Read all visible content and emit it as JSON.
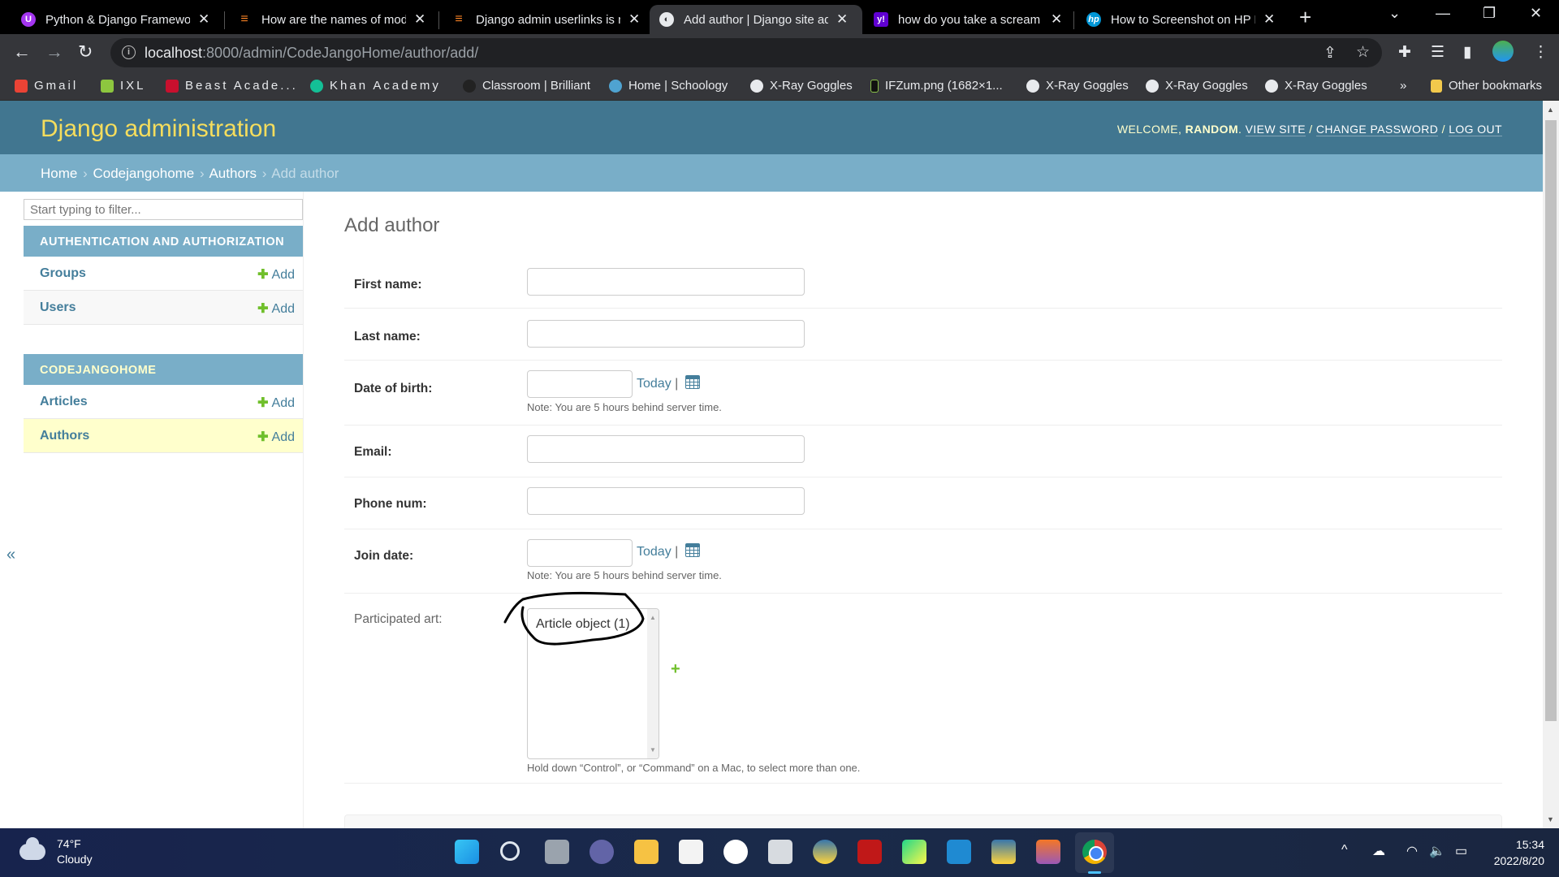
{
  "browser": {
    "tabs": [
      {
        "title": "Python & Django Framework",
        "favicon": "udemy-icon",
        "color": "#a435f0",
        "active": false
      },
      {
        "title": "How are the names of models",
        "favicon": "stackoverflow-icon",
        "color": "#f48024",
        "active": false
      },
      {
        "title": "Django admin userlinks is not",
        "favicon": "stackoverflow-icon",
        "color": "#f48024",
        "active": false
      },
      {
        "title": "Add author | Django site admin",
        "favicon": "globe-icon",
        "color": "#e8eaed",
        "active": true
      },
      {
        "title": "how do you take a scream shot",
        "favicon": "yahoo-icon",
        "color": "#6001d2",
        "active": false
      },
      {
        "title": "How to Screenshot on HP Laptop",
        "favicon": "hp-icon",
        "color": "#0096d6",
        "active": false
      }
    ],
    "close_glyph": "✕",
    "new_tab_glyph": "+",
    "url_host": "localhost",
    "url_rest": ":8000/admin/CodeJangoHome/author/add/",
    "bookmarks": [
      {
        "label": "Gmail",
        "icon": "gmail-icon",
        "color": "#ea4335"
      },
      {
        "label": "IXL",
        "icon": "ixl-icon",
        "color": "#8dc63f"
      },
      {
        "label": "Beast Acade...",
        "icon": "beast-academy-icon",
        "color": "#c8102e"
      },
      {
        "label": "Khan Academy",
        "icon": "khan-academy-icon",
        "color": "#14bf96"
      },
      {
        "label": "Classroom | Brilliant",
        "icon": "brilliant-icon",
        "color": "#222"
      },
      {
        "label": "Home | Schoology",
        "icon": "schoology-icon",
        "color": "#4fa3d1"
      },
      {
        "label": "X-Ray Goggles",
        "icon": "globe-icon",
        "color": "#e8eaed"
      },
      {
        "label": "IFZum.png (1682×1...",
        "icon": "image-icon",
        "color": "#8bc34a"
      },
      {
        "label": "X-Ray Goggles",
        "icon": "globe-icon",
        "color": "#e8eaed"
      },
      {
        "label": "X-Ray Goggles",
        "icon": "globe-icon",
        "color": "#e8eaed"
      },
      {
        "label": "X-Ray Goggles",
        "icon": "globe-icon",
        "color": "#e8eaed"
      }
    ],
    "more_bookmarks": "»",
    "other_bookmarks": "Other bookmarks"
  },
  "admin": {
    "brand": "Django administration",
    "welcome": "WELCOME, ",
    "username": "RANDOM",
    "view_site": "VIEW SITE",
    "change_password": "CHANGE PASSWORD",
    "log_out": "LOG OUT",
    "slash": " / ",
    "breadcrumbs": [
      "Home",
      "Codejangohome",
      "Authors",
      "Add author"
    ],
    "breadcrumb_sep": "›"
  },
  "sidebar": {
    "filter_placeholder": "Start typing to filter...",
    "collapse_glyph": "«",
    "modules": [
      {
        "caption": "AUTHENTICATION AND AUTHORIZATION",
        "rows": [
          {
            "name": "Groups",
            "add": "Add"
          },
          {
            "name": "Users",
            "add": "Add"
          }
        ]
      },
      {
        "caption": "CODEJANGOHOME",
        "rows": [
          {
            "name": "Articles",
            "add": "Add"
          },
          {
            "name": "Authors",
            "add": "Add",
            "current": true
          }
        ]
      }
    ]
  },
  "form": {
    "title": "Add author",
    "fields": {
      "first_name": {
        "label": "First name:",
        "value": ""
      },
      "last_name": {
        "label": "Last name:",
        "value": ""
      },
      "date_of_birth": {
        "label": "Date of birth:",
        "value": "",
        "today": "Today",
        "sep": "|",
        "note": "Note: You are 5 hours behind server time."
      },
      "email": {
        "label": "Email:",
        "value": ""
      },
      "phone_num": {
        "label": "Phone num:",
        "value": ""
      },
      "join_date": {
        "label": "Join date:",
        "value": "",
        "today": "Today",
        "sep": "|",
        "note": "Note: You are 5 hours behind server time."
      },
      "participated_art": {
        "label": "Participated art:",
        "options": [
          "Article object (1)"
        ],
        "add_glyph": "+",
        "help": "Hold down “Control”, or “Command” on a Mac, to select more than one."
      }
    }
  },
  "taskbar": {
    "weather_temp": "74°F",
    "weather_desc": "Cloudy",
    "time": "15:34",
    "date": "2022/8/20",
    "apps": [
      "start-icon",
      "search-icon",
      "task-view-icon",
      "teams-chat-icon",
      "file-explorer-icon",
      "ms-store-icon",
      "github-icon",
      "notepad-icon",
      "python-idle-icon",
      "help-icon",
      "mcafee-icon",
      "pycharm-icon",
      "vscode-icon",
      "python-icon",
      "jupyter-icon",
      "chrome-icon"
    ]
  }
}
